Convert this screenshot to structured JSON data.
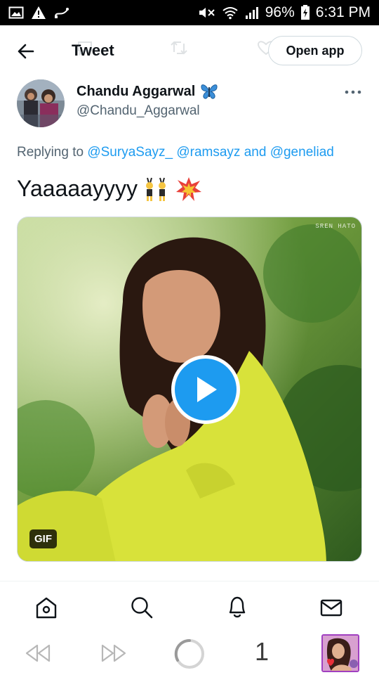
{
  "status_bar": {
    "battery": "96%",
    "time": "6:31 PM",
    "icons": [
      "image-icon",
      "warning-icon",
      "usb-icon",
      "mute-icon",
      "wifi-icon",
      "signal-icon",
      "battery-charging-icon"
    ]
  },
  "header": {
    "title": "Tweet",
    "open_app_label": "Open app",
    "back_icon": "back-arrow-icon"
  },
  "author": {
    "name": "Chandu Aggarwal",
    "handle": "@Chandu_Aggarwal",
    "name_emoji": "butterfly"
  },
  "reply": {
    "prefix": "Replying to",
    "mentions": [
      "@SuryaSayz_",
      "@ramsayz",
      "@geneliad"
    ],
    "joiner": "and"
  },
  "tweet": {
    "text": "Yaaaaayyyy",
    "emojis": [
      "people-with-bunny-ears",
      "collision"
    ]
  },
  "media": {
    "badge": "GIF",
    "watermark": "SREN HATO",
    "colors": {
      "play": "#1d9bf0",
      "dress": "#d8e23a"
    }
  },
  "tabbar": {
    "items": [
      "home-icon",
      "search-icon",
      "notifications-icon",
      "messages-icon"
    ]
  },
  "browser": {
    "tab_count": "1",
    "buttons": [
      "back-icon",
      "forward-icon",
      "loading-icon"
    ]
  }
}
